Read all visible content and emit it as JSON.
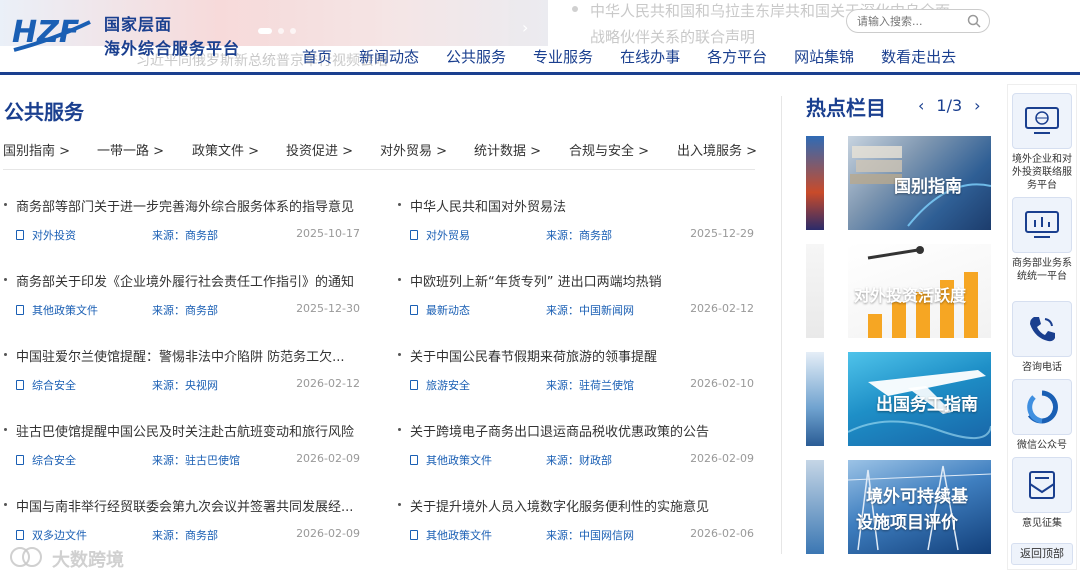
{
  "header": {
    "ghost_headline_1": "中华人民共和国和乌拉圭东岸共和国关于深化中乌全面",
    "ghost_headline_2": "战略伙伴关系的联合声明",
    "ghost_headline_3": "习近平同俄罗斯新总统普京举行视频会晤",
    "logo_line1": "国家层面",
    "logo_line2": "海外综合服务平台",
    "search_placeholder": "请输入搜索...",
    "nav": [
      "首页",
      "新闻动态",
      "公共服务",
      "专业服务",
      "在线办事",
      "各方平台",
      "网站集锦",
      "数看走出去"
    ]
  },
  "public_service": {
    "title": "公共服务",
    "categories": [
      "国别指南 >",
      "一带一路 >",
      "政策文件 >",
      "投资促进 >",
      "对外贸易 >",
      "统计数据 >",
      "合规与安全 >",
      "出入境服务 >"
    ],
    "news": [
      {
        "title": "商务部等部门关于进一步完善海外综合服务体系的指导意见",
        "tag": "对外投资",
        "source": "来源：商务部",
        "date": "2025-10-17"
      },
      {
        "title": "中华人民共和国对外贸易法",
        "tag": "对外贸易",
        "source": "来源：商务部",
        "date": "2025-12-29"
      },
      {
        "title": "商务部关于印发《企业境外履行社会责任工作指引》的通知",
        "tag": "其他政策文件",
        "source": "来源：商务部",
        "date": "2025-12-30"
      },
      {
        "title": "中欧班列上新“年货专列” 进出口两端均热销",
        "tag": "最新动态",
        "source": "来源：中国新闻网",
        "date": "2026-02-12"
      },
      {
        "title": "中国驻爱尔兰使馆提醒：警惕非法中介陷阱 防范务工欠...",
        "tag": "综合安全",
        "source": "来源：央视网",
        "date": "2026-02-12"
      },
      {
        "title": "关于中国公民春节假期来荷旅游的领事提醒",
        "tag": "旅游安全",
        "source": "来源：驻荷兰使馆",
        "date": "2026-02-10"
      },
      {
        "title": "驻古巴使馆提醒中国公民及时关注赴古航班变动和旅行风险",
        "tag": "综合安全",
        "source": "来源：驻古巴使馆",
        "date": "2026-02-09"
      },
      {
        "title": "关于跨境电子商务出口退运商品税收优惠政策的公告",
        "tag": "其他政策文件",
        "source": "来源：财政部",
        "date": "2026-02-09"
      },
      {
        "title": "中国与南非举行经贸联委会第九次会议并签署共同发展经...",
        "tag": "双多边文件",
        "source": "来源：商务部",
        "date": "2026-02-09"
      },
      {
        "title": "关于提升境外人员入境数字化服务便利性的实施意见",
        "tag": "其他政策文件",
        "source": "来源：中国网信网",
        "date": "2026-02-06"
      }
    ]
  },
  "hot": {
    "title": "热点栏目",
    "prev": "‹",
    "page": "1/3",
    "next": "›",
    "cards": [
      "国别指南",
      "对外投资活跃度",
      "出国务工指南",
      "境外可持续基",
      "设施项目评价"
    ]
  },
  "sidebar": {
    "items": [
      "境外企业和对外投资联络服务平台",
      "商务部业务系统统一平台",
      "咨询电话",
      "微信公众号",
      "意见征集"
    ],
    "back_to_top": "返回顶部"
  },
  "watermark": "大数跨境",
  "colors": {
    "brand": "#1a3f8f",
    "link": "#1a5fb4",
    "date": "#999999"
  }
}
